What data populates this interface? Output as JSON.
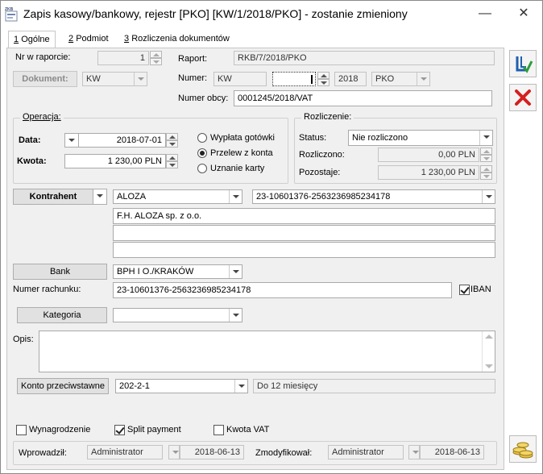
{
  "window": {
    "title": "Zapis kasowy/bankowy, rejestr [PKO] [KW/1/2018/PKO] - zostanie zmieniony",
    "logo_text": "ZKB",
    "minimize": "—",
    "close": "✕"
  },
  "tabs": [
    {
      "key": "1",
      "label": "Ogólne"
    },
    {
      "key": "2",
      "label": "Podmiot"
    },
    {
      "key": "3",
      "label": "Rozliczenia dokumentów"
    }
  ],
  "header": {
    "nr_w_raporcie_label": "Nr w raporcie:",
    "nr_w_raporcie_value": "1",
    "raport_label": "Raport:",
    "raport_value": "RKB/7/2018/PKO",
    "dokument_button": "Dokument:",
    "dokument_value": "KW",
    "numer_label": "Numer:",
    "numer_prefix": "KW",
    "numer_value": "",
    "numer_year": "2018",
    "numer_register": "PKO",
    "numer_obcy_label": "Numer obcy:",
    "numer_obcy_value": "0001245/2018/VAT"
  },
  "operacja": {
    "title": "Operacja:",
    "data_label": "Data:",
    "data_value": "2018-07-01",
    "kwota_label": "Kwota:",
    "kwota_value": "1 230,00 PLN",
    "payment_options": [
      "Wypłata gotówki",
      "Przelew z konta",
      "Uznanie karty"
    ],
    "payment_selected": "Przelew z konta"
  },
  "rozliczenie": {
    "title": "Rozliczenie:",
    "status_label": "Status:",
    "status_value": "Nie rozliczono",
    "rozliczono_label": "Rozliczono:",
    "rozliczono_value": "0,00 PLN",
    "pozostaje_label": "Pozostaje:",
    "pozostaje_value": "1 230,00 PLN"
  },
  "kontrahent": {
    "button": "Kontrahent",
    "code": "ALOZA",
    "account": "23-10601376-2563236985234178",
    "name_line1": "F.H. ALOZA sp. z o.o.",
    "name_line2": "",
    "name_line3": ""
  },
  "bank": {
    "button": "Bank",
    "value": "BPH I O./KRAKÓW",
    "numer_rachunku_label": "Numer rachunku:",
    "numer_rachunku_value": "23-10601376-2563236985234178",
    "iban_label": "IBAN",
    "iban_checked": true
  },
  "kategoria": {
    "button": "Kategoria",
    "value": ""
  },
  "opis": {
    "label": "Opis:",
    "value": ""
  },
  "konto": {
    "button": "Konto przeciwstawne",
    "value": "202-2-1",
    "description": "Do 12 miesięcy"
  },
  "checkboxes": [
    {
      "label": "Wynagrodzenie",
      "checked": false
    },
    {
      "label": "Split payment",
      "checked": true
    },
    {
      "label": "Kwota VAT",
      "checked": false
    }
  ],
  "footer": {
    "wprowadzil_label": "Wprowadził:",
    "wprowadzil_user": "Administrator",
    "wprowadzil_date": "2018-06-13",
    "zmodyfikowal_label": "Zmodyfikował:",
    "zmodyfikowal_user": "Administrator",
    "zmodyfikowal_date": "2018-06-13"
  },
  "colors": {
    "save_icon": "#1f5fb0",
    "cancel_icon": "#d42020"
  },
  "icons": {
    "save": "save-icon",
    "cancel": "cancel-icon",
    "coins": "coins-icon"
  }
}
